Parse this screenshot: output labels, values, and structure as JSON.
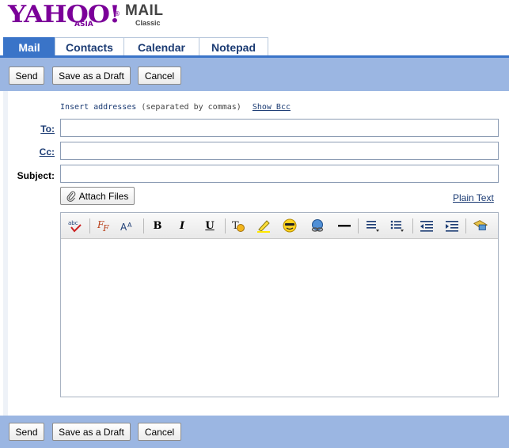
{
  "brand": {
    "logo": "YAHOO!",
    "region": "ASIA",
    "reg_mark": "®",
    "product": "MAIL",
    "edition": "Classic",
    "brand_color": "#7b0099"
  },
  "tabs": [
    {
      "label": "Mail",
      "active": true
    },
    {
      "label": "Contacts",
      "active": false
    },
    {
      "label": "Calendar",
      "active": false
    },
    {
      "label": "Notepad",
      "active": false
    }
  ],
  "toolbar": {
    "send_label": "Send",
    "draft_label": "Save as a Draft",
    "cancel_label": "Cancel"
  },
  "compose": {
    "hint_main": "Insert addresses",
    "hint_rest": "(separated by commas)",
    "show_bcc": "Show Bcc",
    "to_label": "To:",
    "cc_label": "Cc:",
    "subject_label": "Subject:",
    "to_value": "",
    "cc_value": "",
    "subject_value": "",
    "attach_label": "Attach Files",
    "plain_text": "Plain Text",
    "body_value": ""
  },
  "editor_tools": [
    "spellcheck-icon",
    "font-face-icon",
    "font-size-icon",
    "bold-icon",
    "italic-icon",
    "underline-icon",
    "text-color-icon",
    "highlight-icon",
    "emoticon-icon",
    "hyperlink-icon",
    "horizontal-rule-icon",
    "align-icon",
    "bullet-list-icon",
    "outdent-icon",
    "indent-icon",
    "stationery-icon"
  ],
  "colors": {
    "accent": "#3a74c8",
    "toolbar_bg": "#9bb6e2",
    "link": "#1b3b73"
  }
}
